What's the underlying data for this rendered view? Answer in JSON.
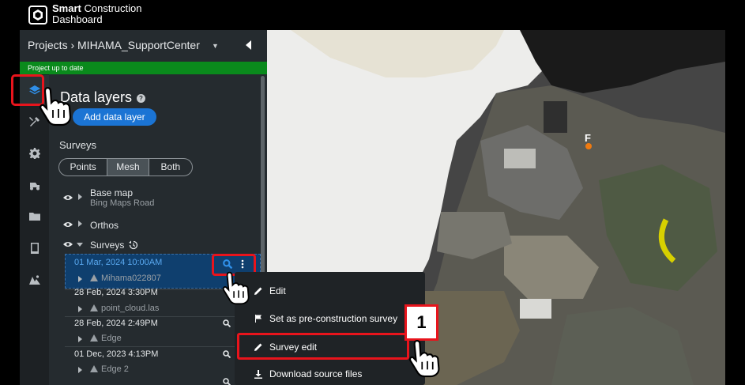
{
  "app": {
    "brand_line1": "Smart",
    "brand_line1b": "Construction",
    "brand_line2": "Dashboard"
  },
  "project": {
    "breadcrumb": "Projects › MIHAMA_SupportCenter",
    "status": "Project up to date"
  },
  "panel": {
    "title": "Data layers",
    "add_button": "Add data layer",
    "surveys_label": "Surveys",
    "view_modes": [
      "Points",
      "Mesh",
      "Both"
    ],
    "selected_view_mode": "Mesh"
  },
  "layers": {
    "base_map": {
      "label": "Base map",
      "sub": "Bing Maps Road"
    },
    "orthos": {
      "label": "Orthos"
    },
    "surveys": {
      "label": "Surveys"
    }
  },
  "surveys": [
    {
      "date": "01 Mar, 2024 10:00AM",
      "name": "Mihama022807",
      "selected": true
    },
    {
      "date": "28 Feb, 2024 3:30PM",
      "name": "point_cloud.las",
      "selected": false
    },
    {
      "date": "28 Feb, 2024 2:49PM",
      "name": "Edge",
      "selected": false
    },
    {
      "date": "01 Dec, 2023 4:13PM",
      "name": "Edge 2",
      "selected": false
    }
  ],
  "context_menu": {
    "items": [
      "Edit",
      "Set as pre-construction survey",
      "Survey edit",
      "Download source files"
    ],
    "highlighted": "Survey edit"
  },
  "map": {
    "marker_label": "F"
  },
  "annotation": {
    "step_number": "1"
  },
  "colors": {
    "accent": "#1b74d4",
    "status_green": "#0a8a1c",
    "highlight_red": "#e8141c",
    "panel_bg": "#252b2f"
  }
}
